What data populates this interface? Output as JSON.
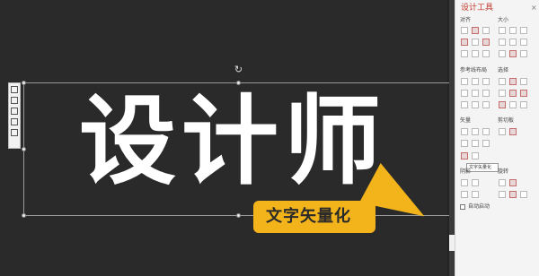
{
  "canvas": {
    "main_text": "设计师",
    "callout_label": "文字矢量化",
    "rotate_glyph": "↻"
  },
  "panel": {
    "title": "设计工具",
    "close_glyph": "×",
    "sections": {
      "align": "对齐",
      "size": "大小",
      "guides": "参考线布局",
      "select": "选择",
      "vector": "矢量",
      "clip": "剪切板",
      "shadow": "阴影",
      "adjust": "旋转"
    },
    "tooltip": "文字矢量化",
    "auto_label": "自动启动"
  },
  "colors": {
    "accent": "#f2b31b",
    "panel_title": "#c0392b"
  }
}
